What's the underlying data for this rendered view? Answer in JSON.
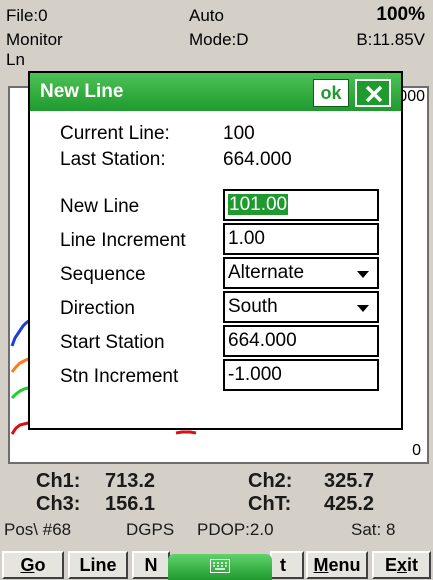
{
  "status": {
    "file": "File:0",
    "mode": "Auto",
    "battery_pct": "100%",
    "monitor": "Monitor",
    "mode_d": "Mode:D",
    "battery_v": "B:11.85V",
    "line_label": "Ln"
  },
  "plot": {
    "top_value": "000",
    "bottom_value": "0"
  },
  "dialog": {
    "title": "New Line",
    "ok_label": "ok",
    "current_line_label": "Current Line:",
    "current_line_value": "100",
    "last_station_label": "Last Station:",
    "last_station_value": "664.000",
    "new_line_label": "New Line",
    "new_line_value": "101.00",
    "line_increment_label": "Line Increment",
    "line_increment_value": "1.00",
    "sequence_label": "Sequence",
    "sequence_value": "Alternate",
    "direction_label": "Direction",
    "direction_value": "South",
    "start_station_label": "Start Station",
    "start_station_value": "664.000",
    "stn_increment_label": "Stn Increment",
    "stn_increment_value": "-1.000"
  },
  "readouts": {
    "ch1_label": "Ch1:",
    "ch1_value": "713.2",
    "ch2_label": "Ch2:",
    "ch2_value": "325.7",
    "ch3_label": "Ch3:",
    "ch3_value": "156.1",
    "cht_label": "ChT:",
    "cht_value": "425.2",
    "pos": "Pos\\ #68",
    "gps": "DGPS",
    "pdop": "PDOP:2.0",
    "sat": "Sat: 8"
  },
  "buttons": {
    "go": "o",
    "go_underlined": "G",
    "line": "Line",
    "b3": "N",
    "b4": "t",
    "menu_rest": "enu",
    "menu_underlined": "M",
    "exit_a": "E",
    "exit_u": "x",
    "exit_b": "it"
  },
  "colors": {
    "title_green": "#1f9a2e",
    "trace_blue": "#1b3fd6",
    "trace_orange": "#ff7a1a",
    "trace_green": "#1fcf2a",
    "trace_red": "#d81010"
  }
}
